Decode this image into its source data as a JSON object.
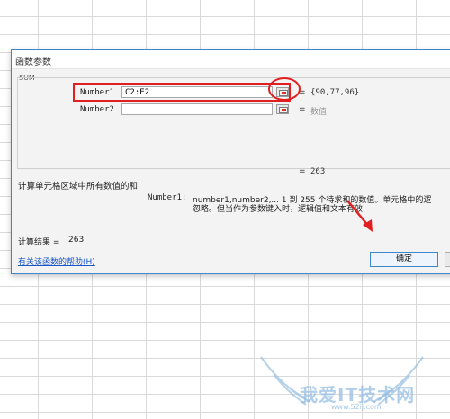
{
  "dialog": {
    "title": "函数参数",
    "function_name": "SUM",
    "args": [
      {
        "label": "Number1",
        "value": "C2:E2",
        "result": "{90,77,96}"
      },
      {
        "label": "Number2",
        "value": "",
        "result": "数值"
      }
    ],
    "equals": "=",
    "formula_result_top": "263",
    "description": "计算单元格区域中所有数值的和",
    "arg_help_name": "Number1:",
    "arg_help_line1": "number1,number2,...  1 到 255 个待求和的数值。单元格中的逻",
    "arg_help_line2": "忽略。但当作为参数键入时，逻辑值和文本有效",
    "calc_result_label": "计算结果 =",
    "calc_result_value": "263",
    "help_link": "有关该函数的帮助(H)",
    "ok_button": "确定"
  },
  "watermark": {
    "text": "我爱IT技术网",
    "sub": "www.52ij.com"
  },
  "colors": {
    "accent": "#3c87c8",
    "annotation": "#e02020",
    "link": "#1a56c8"
  }
}
